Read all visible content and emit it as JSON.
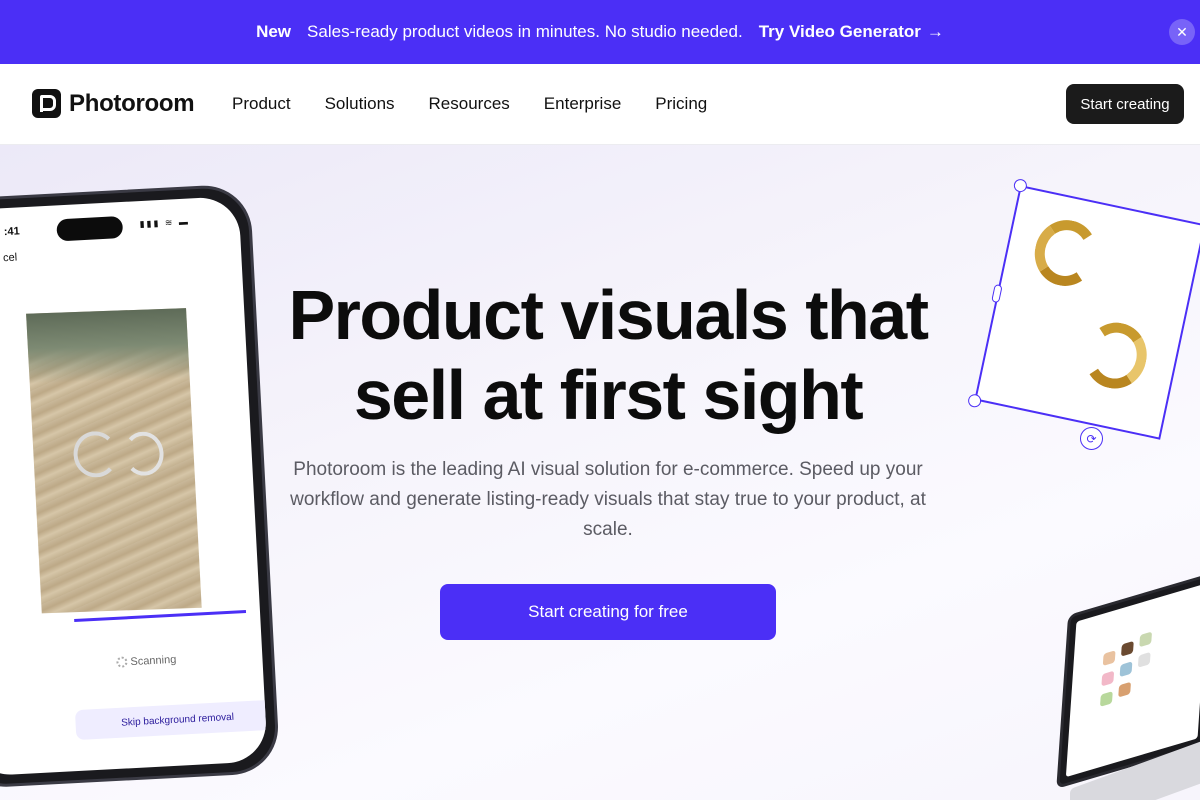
{
  "banner": {
    "tag": "New",
    "message": "Sales-ready product videos in minutes. No studio needed.",
    "link_label": "Try Video Generator",
    "link_arrow": "→",
    "close_glyph": "✕"
  },
  "nav": {
    "logo": "Photoroom",
    "items": [
      {
        "label": "Product"
      },
      {
        "label": "Solutions"
      },
      {
        "label": "Resources"
      },
      {
        "label": "Enterprise"
      },
      {
        "label": "Pricing"
      }
    ],
    "cta": "Start creating"
  },
  "hero": {
    "headline_line1": "Product visuals that",
    "headline_line2": "sell at first sight",
    "subtitle": "Photoroom is the leading AI visual solution for e-commerce. Speed up your workflow and generate listing-ready visuals that stay true to your product, at scale.",
    "cta": "Start creating for free"
  },
  "phone": {
    "time": ":41",
    "cancel": "cel",
    "status": "▮▮▮ ≋ ▬",
    "scanning": "Scanning",
    "skip": "Skip background removal"
  },
  "colors": {
    "brand": "#4b2ff6",
    "dark_button": "#1b1b1b"
  },
  "icons": {
    "close": "close-icon",
    "arrow": "arrow-right-icon",
    "rotate": "rotate-icon"
  }
}
